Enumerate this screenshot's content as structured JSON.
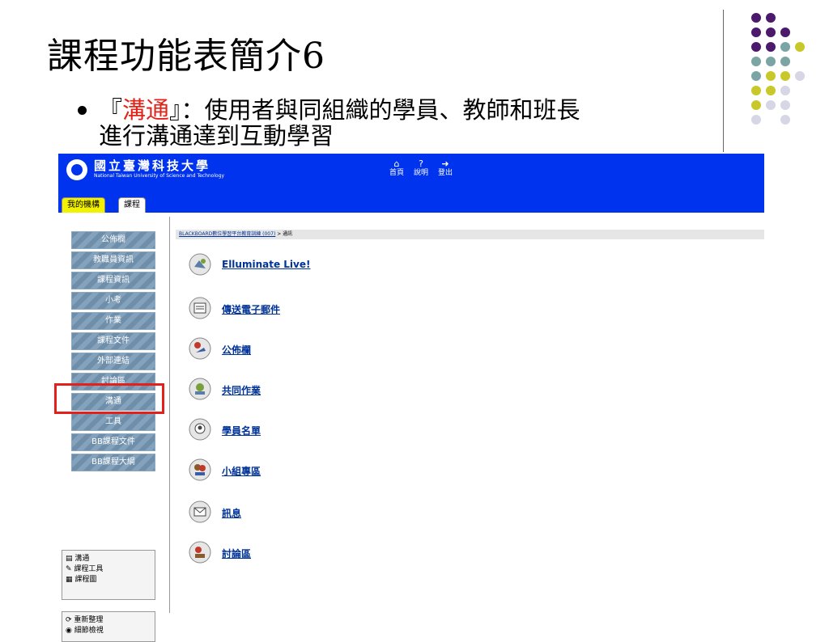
{
  "slide": {
    "title": "課程功能表簡介6",
    "bullet": {
      "open_quote": "『",
      "keyword": "溝通",
      "rest": "』：使用者與同組織的學員、教師和班長",
      "line2": "進行溝通達到互動學習"
    }
  },
  "colors": {
    "accent_red": "#e2231a",
    "header_blue": "#0033ee",
    "dot_purple": "#4b1a6b",
    "dot_teal": "#7aa5a4",
    "dot_yellow": "#c8c82a",
    "dot_lavender": "#d6d6e6"
  },
  "blackboard": {
    "university_cn": "國立臺灣科技大學",
    "university_en": "National Taiwan University of Science and Technology",
    "top_links": [
      {
        "icon": "home-icon",
        "label": "首頁"
      },
      {
        "icon": "help-icon",
        "label": "說明"
      },
      {
        "icon": "logout-icon",
        "label": "登出"
      }
    ],
    "tabs": [
      "我的機構",
      "課程"
    ],
    "nav": [
      "公佈欄",
      "教職員資訊",
      "課程資訊",
      "小考",
      "作業",
      "課程文件",
      "外部連結",
      "討論區",
      "溝通",
      "工具",
      "BB課程文件",
      "BB課程大綱"
    ],
    "panel1": [
      "溝通",
      "課程工具",
      "課程圖"
    ],
    "panel2": [
      "重新整理",
      "細節檢視"
    ],
    "breadcrumb": {
      "link": "BLACKBOARD數位學習平台教育訓練 (007)",
      "current": " > 通訊"
    },
    "tools": [
      {
        "icon": "elluminate-icon",
        "label": "Elluminate Live!"
      },
      {
        "icon": "email-icon",
        "label": "傳送電子郵件"
      },
      {
        "icon": "announcement-icon",
        "label": "公佈欄"
      },
      {
        "icon": "group-work-icon",
        "label": "共同作業"
      },
      {
        "icon": "roster-icon",
        "label": "學員名單"
      },
      {
        "icon": "group-area-icon",
        "label": "小組專區"
      },
      {
        "icon": "message-icon",
        "label": "訊息"
      },
      {
        "icon": "discussion-icon",
        "label": "討論區"
      }
    ]
  }
}
